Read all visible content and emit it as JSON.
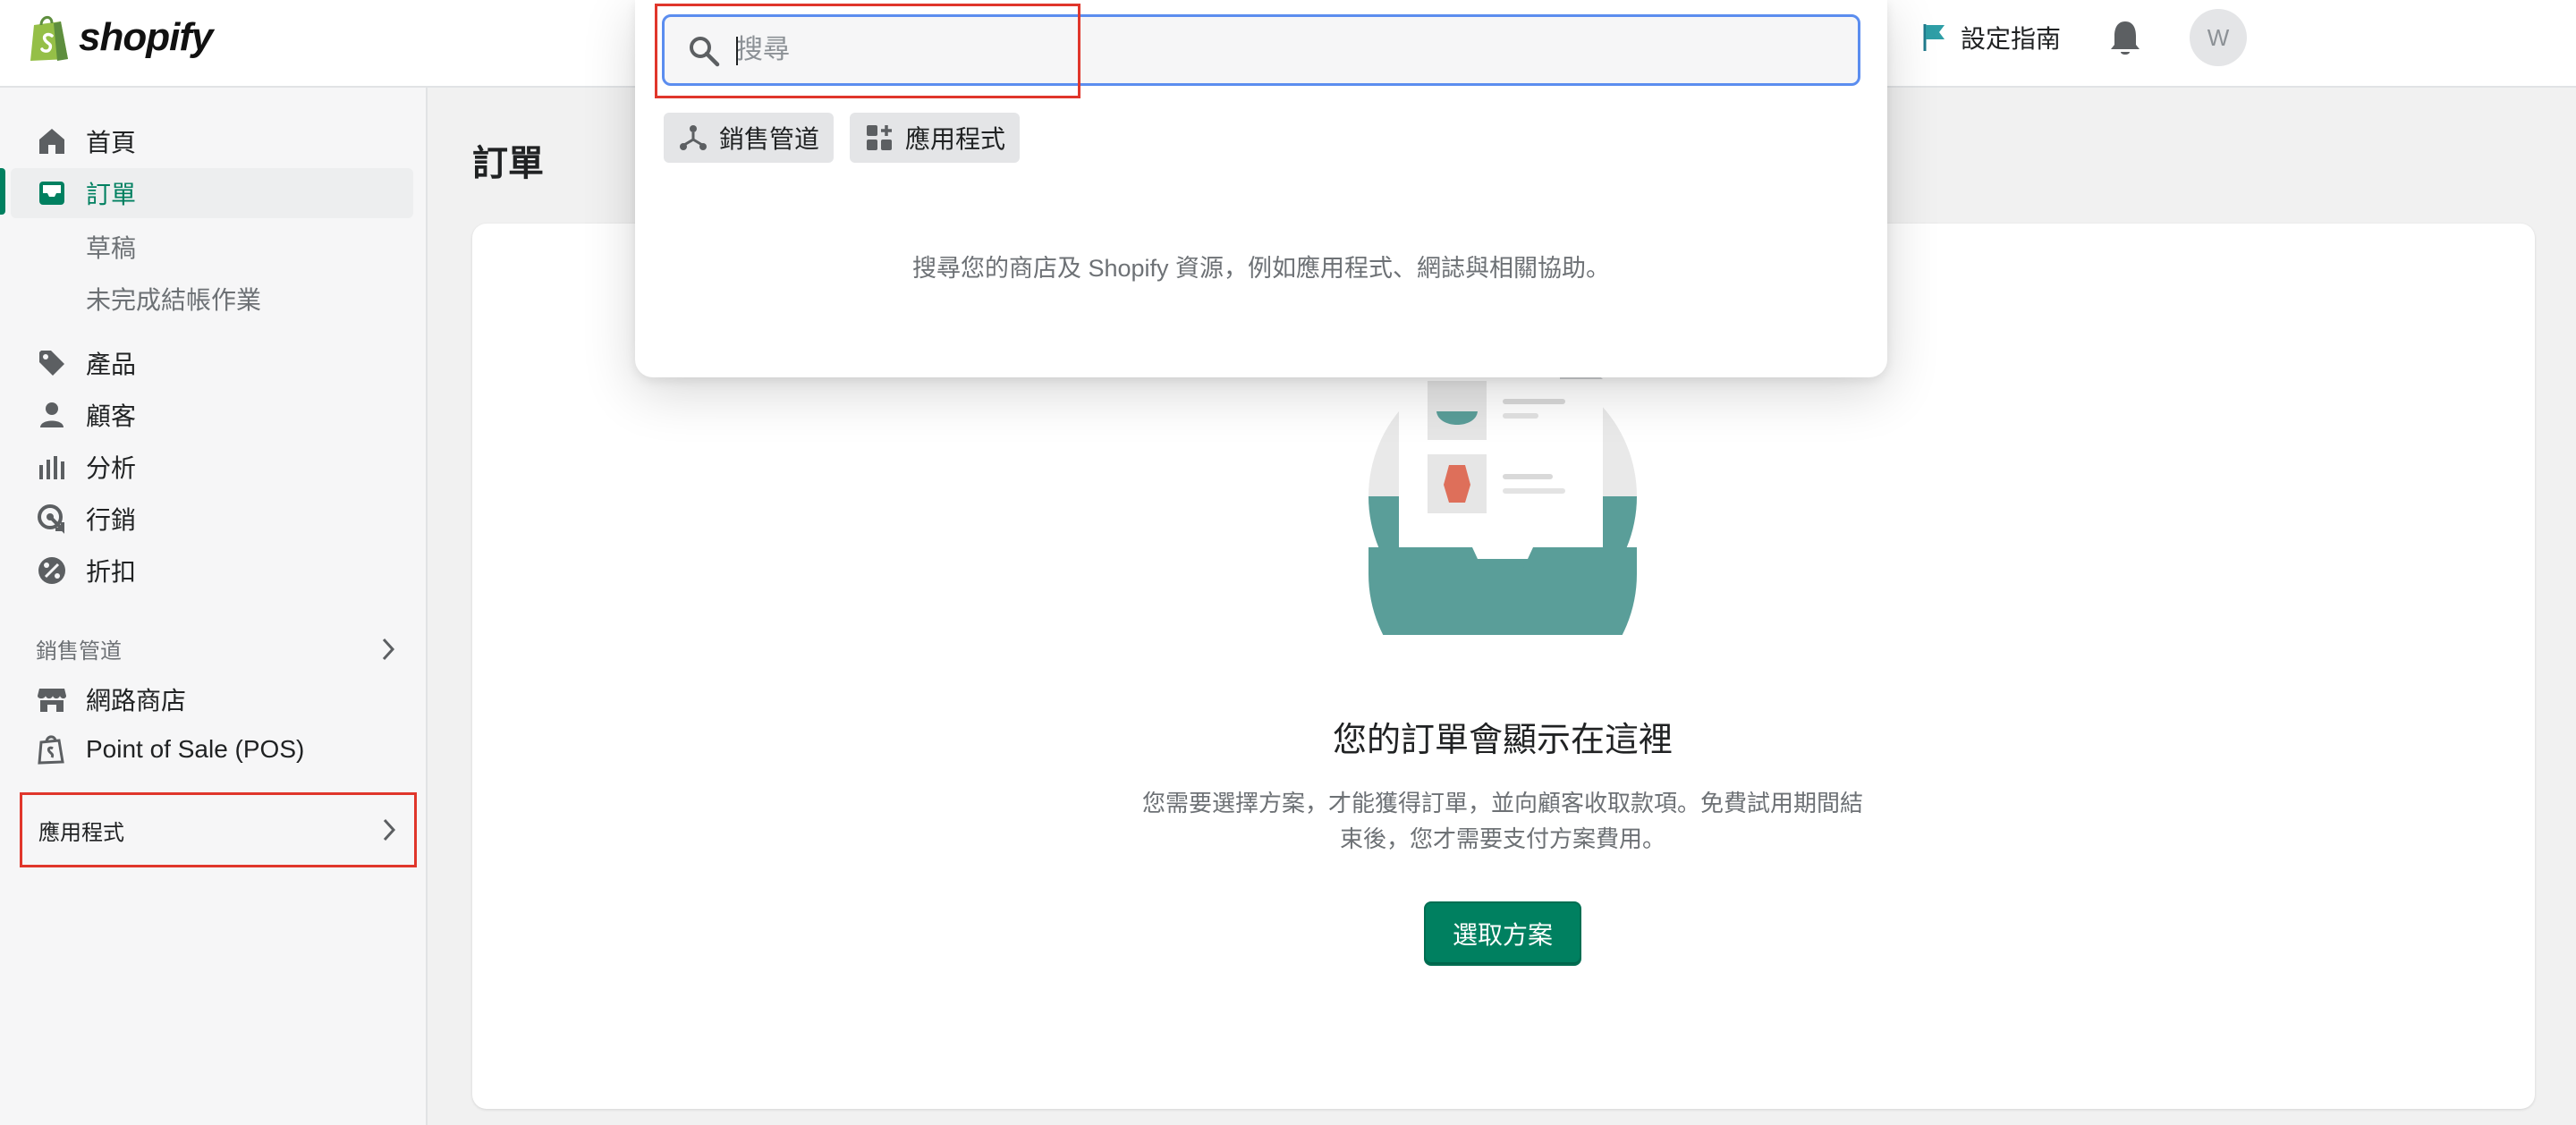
{
  "brand": {
    "name": "shopify",
    "accent": "#008060"
  },
  "header": {
    "setup_guide": "設定指南",
    "avatar_initial": "W"
  },
  "sidebar": {
    "items": [
      {
        "label": "首頁",
        "icon": "home-icon"
      },
      {
        "label": "訂單",
        "icon": "orders-inbox-icon",
        "active": true
      },
      {
        "label": "草稿"
      },
      {
        "label": "未完成結帳作業"
      },
      {
        "label": "產品",
        "icon": "tag-icon"
      },
      {
        "label": "顧客",
        "icon": "person-icon"
      },
      {
        "label": "分析",
        "icon": "bar-chart-icon"
      },
      {
        "label": "行銷",
        "icon": "target-icon"
      },
      {
        "label": "折扣",
        "icon": "discount-icon"
      }
    ],
    "sales_channels": {
      "heading": "銷售管道",
      "items": [
        {
          "label": "網路商店",
          "icon": "store-icon"
        },
        {
          "label": "Point of Sale (POS)",
          "icon": "pos-bag-icon"
        }
      ]
    },
    "apps": {
      "heading": "應用程式"
    }
  },
  "main": {
    "page_title": "訂單",
    "empty_state": {
      "title": "您的訂單會顯示在這裡",
      "description": "您需要選擇方案，才能獲得訂單，並向顧客收取款項。免費試用期間結束後，您才需要支付方案費用。",
      "button": "選取方案"
    }
  },
  "search": {
    "placeholder": "搜尋",
    "value": "",
    "chips": [
      {
        "label": "銷售管道",
        "icon": "sales-channels-icon"
      },
      {
        "label": "應用程式",
        "icon": "apps-icon"
      }
    ],
    "hint": "搜尋您的商店及 Shopify 資源，例如應用程式、網誌與相關協助。"
  }
}
